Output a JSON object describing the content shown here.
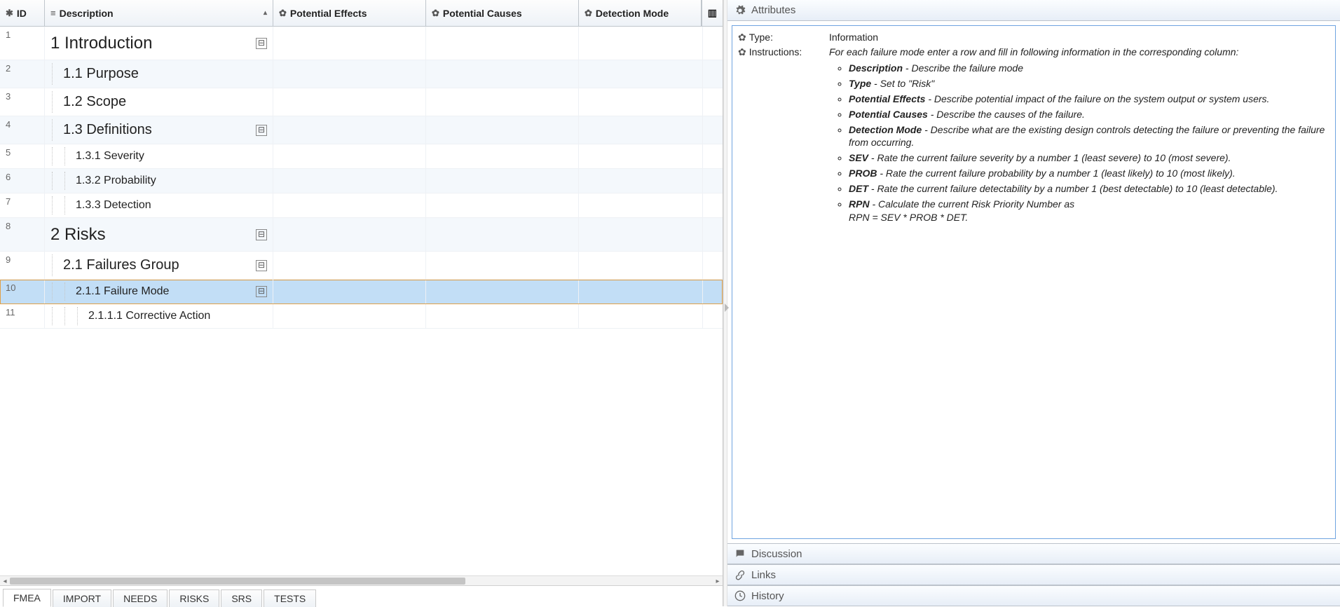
{
  "columns": {
    "id": "ID",
    "description": "Description",
    "potential_effects": "Potential Effects",
    "potential_causes": "Potential Causes",
    "detection_mode": "Detection Mode"
  },
  "rows": [
    {
      "id": "1",
      "level": 1,
      "text": "1 Introduction",
      "collapsible": true,
      "selected": false
    },
    {
      "id": "2",
      "level": 2,
      "text": "1.1 Purpose",
      "collapsible": false,
      "selected": false
    },
    {
      "id": "3",
      "level": 2,
      "text": "1.2 Scope",
      "collapsible": false,
      "selected": false
    },
    {
      "id": "4",
      "level": 2,
      "text": "1.3 Definitions",
      "collapsible": true,
      "selected": false
    },
    {
      "id": "5",
      "level": 3,
      "text": "1.3.1 Severity",
      "collapsible": false,
      "selected": false
    },
    {
      "id": "6",
      "level": 3,
      "text": "1.3.2 Probability",
      "collapsible": false,
      "selected": false
    },
    {
      "id": "7",
      "level": 3,
      "text": "1.3.3 Detection",
      "collapsible": false,
      "selected": false
    },
    {
      "id": "8",
      "level": 1,
      "text": "2 Risks",
      "collapsible": true,
      "selected": false
    },
    {
      "id": "9",
      "level": 2,
      "text": "2.1 Failures Group",
      "collapsible": true,
      "selected": false
    },
    {
      "id": "10",
      "level": 3,
      "text": "2.1.1 Failure Mode",
      "collapsible": true,
      "selected": true
    },
    {
      "id": "11",
      "level": 4,
      "text": "2.1.1.1 Corrective Action",
      "collapsible": false,
      "selected": false
    }
  ],
  "tabs": [
    {
      "label": "FMEA",
      "active": true
    },
    {
      "label": "IMPORT",
      "active": false
    },
    {
      "label": "NEEDS",
      "active": false
    },
    {
      "label": "RISKS",
      "active": false
    },
    {
      "label": "SRS",
      "active": false
    },
    {
      "label": "TESTS",
      "active": false
    }
  ],
  "right": {
    "attributes_title": "Attributes",
    "discussion_title": "Discussion",
    "links_title": "Links",
    "history_title": "History",
    "type_label": "Type:",
    "type_value": "Information",
    "instructions_label": "Instructions:",
    "instructions_intro": "For each failure mode enter a row and fill in following information in the corresponding column:",
    "bullets": [
      {
        "term": "Description",
        "rest": " - Describe the failure mode"
      },
      {
        "term": "Type",
        "rest": " - Set to \"Risk\""
      },
      {
        "term": "Potential Effects",
        "rest": " - Describe potential impact of the failure on the system output or system users."
      },
      {
        "term": "Potential Causes",
        "rest": " - Describe the causes of the failure."
      },
      {
        "term": "Detection Mode",
        "rest": " - Describe what are the existing design controls detecting the failure or preventing the failure from occurring."
      },
      {
        "term": "SEV",
        "rest": " - Rate the current failure severity by a number 1 (least severe) to 10 (most severe)."
      },
      {
        "term": "PROB",
        "rest": " - Rate the current failure probability by a number 1 (least likely) to 10 (most likely)."
      },
      {
        "term": "DET",
        "rest": " - Rate the current failure detectability by a number 1 (best detectable) to 10 (least detectable)."
      },
      {
        "term": "RPN",
        "rest": " - Calculate the current Risk Priority Number as",
        "extra": "RPN = SEV * PROB * DET."
      }
    ]
  }
}
